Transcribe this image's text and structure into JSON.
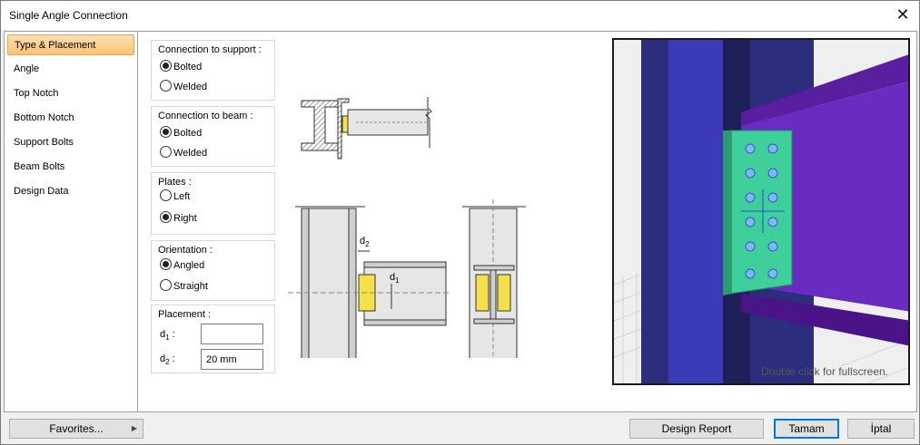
{
  "window": {
    "title": "Single Angle Connection"
  },
  "sidebar": {
    "items": [
      {
        "label": "Type & Placement",
        "active": true
      },
      {
        "label": "Angle"
      },
      {
        "label": "Top Notch"
      },
      {
        "label": "Bottom Notch"
      },
      {
        "label": "Support Bolts"
      },
      {
        "label": "Beam Bolts"
      },
      {
        "label": "Design Data"
      }
    ]
  },
  "form": {
    "support": {
      "title": "Connection to support :",
      "options": [
        "Bolted",
        "Welded"
      ],
      "selected": "Bolted"
    },
    "beam": {
      "title": "Connection to beam :",
      "options": [
        "Bolted",
        "Welded"
      ],
      "selected": "Bolted"
    },
    "plates": {
      "title": "Plates :",
      "options": [
        "Left",
        "Right"
      ],
      "selected": "Right"
    },
    "orientation": {
      "title": "Orientation :",
      "options": [
        "Angled",
        "Straight"
      ],
      "selected": "Angled"
    },
    "placement": {
      "title": "Placement :",
      "d1_label": "d",
      "d1_sub": "1",
      "d1_suffix": " :",
      "d1_value": "",
      "d2_label": "d",
      "d2_sub": "2",
      "d2_suffix": " :",
      "d2_value": "20 mm"
    }
  },
  "diagram": {
    "d1": "d",
    "d1_sub": "1",
    "d2": "d",
    "d2_sub": "2"
  },
  "viewport": {
    "hint": "Double click for fullscreen."
  },
  "buttons": {
    "favorites": "Favorites...",
    "design_report": "Design Report",
    "ok": "Tamam",
    "cancel": "İptal"
  },
  "colors": {
    "accent": "#fbc274",
    "column": "#2a2a7a",
    "beam": "#5a1ea0",
    "angle": "#3fcf9b",
    "weld_plate": "#f5e04a"
  }
}
